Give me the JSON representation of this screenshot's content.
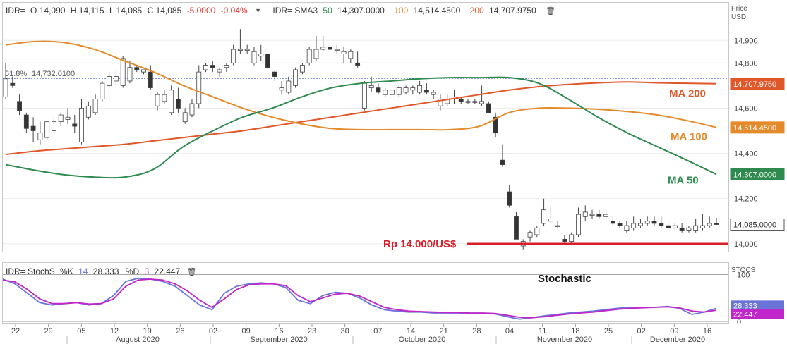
{
  "legend": {
    "symbol": "IDR=",
    "open_label": "O",
    "open": "14,090",
    "high_label": "H",
    "high": "14,115",
    "low_label": "L",
    "low": "14,085",
    "close_label": "C",
    "close": "14,085",
    "change": "-5.0000",
    "change_pct": "-0.04%",
    "sma_symbol": "IDR= SMA3",
    "sma50_period": "50",
    "sma50_value": "14,307.0000",
    "sma100_period": "100",
    "sma100_value": "14,514.4500",
    "sma200_period": "200",
    "sma200_value": "14,707.9750"
  },
  "stoch_legend": {
    "label": "IDR= StochS",
    "k_label": "%K",
    "k_period": "14",
    "k_value": "28.333",
    "d_label": "%D",
    "d_period": "3",
    "d_value": "22.447"
  },
  "axis": {
    "price_title": "Price",
    "price_unit": "USD",
    "price_ticks": [
      "14,000",
      "14,200",
      "14,400",
      "14,600",
      "14,800",
      "14,900"
    ],
    "price_tick_values": [
      14000,
      14200,
      14400,
      14600,
      14800,
      14900
    ],
    "stoch_title": "STOCS",
    "stoch_ticks": [
      "0",
      "100"
    ],
    "stoch_tick_values": [
      0,
      100
    ],
    "date_ticks": [
      "22",
      "29",
      "05",
      "12",
      "19",
      "26",
      "02",
      "09",
      "16",
      "23",
      "30",
      "07",
      "14",
      "21",
      "28",
      "04",
      "11",
      "18",
      "25",
      "02",
      "09",
      "16"
    ],
    "month_labels": [
      "August 2020",
      "September 2020",
      "October 2020",
      "November 2020",
      "December 2020"
    ]
  },
  "badges": {
    "ma200": {
      "text": "14,707.9750",
      "color": "#e0572a"
    },
    "ma100": {
      "text": "14,514.4500",
      "color": "#e38a2a"
    },
    "ma50": {
      "text": "14,307.0000",
      "color": "#2f8a4f"
    },
    "last": {
      "text": "14,085.0000",
      "color": "#ffffff"
    },
    "k": {
      "text": "28.333",
      "color": "#6a74d8"
    },
    "d": {
      "text": "22.447",
      "color": "#c026c9"
    }
  },
  "annotations": {
    "fib_label": "61.8%",
    "fib_value": "14,732.0100",
    "ma200_label": "MA 200",
    "ma100_label": "MA 100",
    "ma50_label": "MA 50",
    "support_label": "Rp 14.000/US$",
    "stoch_title": "Stochastic"
  },
  "chart_data": {
    "type": "candlestick",
    "ylim": [
      13965,
      14985
    ],
    "stoch_ylim": [
      -3,
      117
    ],
    "fib_level": 14732.01,
    "support_level": 14000,
    "colors": {
      "sma50": "#2f8a4f",
      "sma100": "#e38a2a",
      "sma200": "#e0572a",
      "support": "#d81e2a",
      "fib": "#3b4fb8",
      "stoch_k": "#6a74d8",
      "stoch_d": "#c026c9",
      "bull": "#ffffff",
      "bear": "#333333"
    },
    "candles": [
      {
        "o": 14650,
        "h": 14800,
        "l": 14640,
        "c": 14730
      },
      {
        "o": 14710,
        "h": 14740,
        "l": 14690,
        "c": 14700
      },
      {
        "o": 14630,
        "h": 14660,
        "l": 14570,
        "c": 14590
      },
      {
        "o": 14570,
        "h": 14580,
        "l": 14490,
        "c": 14510
      },
      {
        "o": 14520,
        "h": 14560,
        "l": 14450,
        "c": 14500
      },
      {
        "o": 14460,
        "h": 14540,
        "l": 14440,
        "c": 14490
      },
      {
        "o": 14470,
        "h": 14530,
        "l": 14460,
        "c": 14540
      },
      {
        "o": 14500,
        "h": 14560,
        "l": 14490,
        "c": 14540
      },
      {
        "o": 14540,
        "h": 14580,
        "l": 14520,
        "c": 14570
      },
      {
        "o": 14550,
        "h": 14600,
        "l": 14530,
        "c": 14560
      },
      {
        "o": 14530,
        "h": 14570,
        "l": 14490,
        "c": 14520
      },
      {
        "o": 14450,
        "h": 14640,
        "l": 14440,
        "c": 14600
      },
      {
        "o": 14560,
        "h": 14630,
        "l": 14550,
        "c": 14610
      },
      {
        "o": 14580,
        "h": 14660,
        "l": 14570,
        "c": 14640
      },
      {
        "o": 14640,
        "h": 14720,
        "l": 14630,
        "c": 14710
      },
      {
        "o": 14700,
        "h": 14760,
        "l": 14690,
        "c": 14740
      },
      {
        "o": 14720,
        "h": 14770,
        "l": 14700,
        "c": 14740
      },
      {
        "o": 14700,
        "h": 14830,
        "l": 14690,
        "c": 14820
      },
      {
        "o": 14720,
        "h": 14810,
        "l": 14710,
        "c": 14780
      },
      {
        "o": 14780,
        "h": 14790,
        "l": 14760,
        "c": 14770
      },
      {
        "o": 14760,
        "h": 14770,
        "l": 14750,
        "c": 14770
      },
      {
        "o": 14760,
        "h": 14790,
        "l": 14680,
        "c": 14690
      },
      {
        "o": 14610,
        "h": 14670,
        "l": 14590,
        "c": 14660
      },
      {
        "o": 14630,
        "h": 14680,
        "l": 14620,
        "c": 14660
      },
      {
        "o": 14580,
        "h": 14700,
        "l": 14570,
        "c": 14680
      },
      {
        "o": 14640,
        "h": 14690,
        "l": 14580,
        "c": 14600
      },
      {
        "o": 14540,
        "h": 14600,
        "l": 14530,
        "c": 14580
      },
      {
        "o": 14570,
        "h": 14640,
        "l": 14560,
        "c": 14620
      },
      {
        "o": 14620,
        "h": 14790,
        "l": 14600,
        "c": 14760
      },
      {
        "o": 14770,
        "h": 14800,
        "l": 14760,
        "c": 14790
      },
      {
        "o": 14790,
        "h": 14810,
        "l": 14760,
        "c": 14780
      },
      {
        "o": 14760,
        "h": 14780,
        "l": 14740,
        "c": 14770
      },
      {
        "o": 14780,
        "h": 14800,
        "l": 14760,
        "c": 14790
      },
      {
        "o": 14800,
        "h": 14880,
        "l": 14790,
        "c": 14860
      },
      {
        "o": 14860,
        "h": 14950,
        "l": 14840,
        "c": 14860
      },
      {
        "o": 14860,
        "h": 14880,
        "l": 14840,
        "c": 14860
      },
      {
        "o": 14800,
        "h": 14870,
        "l": 14790,
        "c": 14850
      },
      {
        "o": 14830,
        "h": 14880,
        "l": 14810,
        "c": 14840
      },
      {
        "o": 14840,
        "h": 14860,
        "l": 14760,
        "c": 14780
      },
      {
        "o": 14760,
        "h": 14770,
        "l": 14720,
        "c": 14740
      },
      {
        "o": 14680,
        "h": 14720,
        "l": 14660,
        "c": 14690
      },
      {
        "o": 14670,
        "h": 14740,
        "l": 14660,
        "c": 14720
      },
      {
        "o": 14700,
        "h": 14780,
        "l": 14690,
        "c": 14770
      },
      {
        "o": 14760,
        "h": 14800,
        "l": 14750,
        "c": 14790
      },
      {
        "o": 14800,
        "h": 14870,
        "l": 14790,
        "c": 14860
      },
      {
        "o": 14820,
        "h": 14920,
        "l": 14810,
        "c": 14860
      },
      {
        "o": 14860,
        "h": 14920,
        "l": 14850,
        "c": 14870
      },
      {
        "o": 14870,
        "h": 14920,
        "l": 14850,
        "c": 14860
      },
      {
        "o": 14860,
        "h": 14880,
        "l": 14840,
        "c": 14860
      },
      {
        "o": 14840,
        "h": 14870,
        "l": 14800,
        "c": 14850
      },
      {
        "o": 14820,
        "h": 14860,
        "l": 14800,
        "c": 14850
      },
      {
        "o": 14800,
        "h": 14850,
        "l": 14780,
        "c": 14790
      },
      {
        "o": 14600,
        "h": 14720,
        "l": 14590,
        "c": 14710
      },
      {
        "o": 14690,
        "h": 14740,
        "l": 14670,
        "c": 14700
      },
      {
        "o": 14690,
        "h": 14710,
        "l": 14660,
        "c": 14670
      },
      {
        "o": 14660,
        "h": 14690,
        "l": 14650,
        "c": 14680
      },
      {
        "o": 14660,
        "h": 14700,
        "l": 14650,
        "c": 14680
      },
      {
        "o": 14660,
        "h": 14700,
        "l": 14650,
        "c": 14690
      },
      {
        "o": 14670,
        "h": 14700,
        "l": 14660,
        "c": 14690
      },
      {
        "o": 14680,
        "h": 14700,
        "l": 14660,
        "c": 14690
      },
      {
        "o": 14670,
        "h": 14720,
        "l": 14660,
        "c": 14700
      },
      {
        "o": 14680,
        "h": 14710,
        "l": 14660,
        "c": 14670
      },
      {
        "o": 14660,
        "h": 14680,
        "l": 14640,
        "c": 14670
      },
      {
        "o": 14610,
        "h": 14660,
        "l": 14590,
        "c": 14640
      },
      {
        "o": 14620,
        "h": 14660,
        "l": 14610,
        "c": 14640
      },
      {
        "o": 14640,
        "h": 14680,
        "l": 14620,
        "c": 14650
      },
      {
        "o": 14640,
        "h": 14650,
        "l": 14620,
        "c": 14630
      },
      {
        "o": 14630,
        "h": 14640,
        "l": 14620,
        "c": 14630
      },
      {
        "o": 14630,
        "h": 14640,
        "l": 14620,
        "c": 14630
      },
      {
        "o": 14620,
        "h": 14700,
        "l": 14610,
        "c": 14630
      },
      {
        "o": 14620,
        "h": 14630,
        "l": 14580,
        "c": 14580
      },
      {
        "o": 14560,
        "h": 14580,
        "l": 14470,
        "c": 14490
      },
      {
        "o": 14370,
        "h": 14440,
        "l": 14340,
        "c": 14350
      },
      {
        "o": 14230,
        "h": 14260,
        "l": 14160,
        "c": 14170
      },
      {
        "o": 14120,
        "h": 14140,
        "l": 14020,
        "c": 14020
      },
      {
        "o": 13990,
        "h": 14020,
        "l": 13975,
        "c": 14010
      },
      {
        "o": 14030,
        "h": 14060,
        "l": 14010,
        "c": 14050
      },
      {
        "o": 14040,
        "h": 14080,
        "l": 14030,
        "c": 14070
      },
      {
        "o": 14090,
        "h": 14200,
        "l": 14080,
        "c": 14150
      },
      {
        "o": 14100,
        "h": 14170,
        "l": 14090,
        "c": 14110
      },
      {
        "o": 14080,
        "h": 14100,
        "l": 14070,
        "c": 14080
      },
      {
        "o": 14020,
        "h": 14040,
        "l": 14000,
        "c": 14010
      },
      {
        "o": 14010,
        "h": 14050,
        "l": 14000,
        "c": 14040
      },
      {
        "o": 14040,
        "h": 14160,
        "l": 14030,
        "c": 14130
      },
      {
        "o": 14120,
        "h": 14170,
        "l": 14100,
        "c": 14140
      },
      {
        "o": 14130,
        "h": 14150,
        "l": 14110,
        "c": 14130
      },
      {
        "o": 14130,
        "h": 14150,
        "l": 14110,
        "c": 14120
      },
      {
        "o": 14120,
        "h": 14150,
        "l": 14100,
        "c": 14130
      },
      {
        "o": 14100,
        "h": 14120,
        "l": 14080,
        "c": 14090
      },
      {
        "o": 14090,
        "h": 14100,
        "l": 14070,
        "c": 14080
      },
      {
        "o": 14060,
        "h": 14100,
        "l": 14050,
        "c": 14080
      },
      {
        "o": 14070,
        "h": 14120,
        "l": 14060,
        "c": 14090
      },
      {
        "o": 14080,
        "h": 14110,
        "l": 14070,
        "c": 14090
      },
      {
        "o": 14090,
        "h": 14120,
        "l": 14080,
        "c": 14100
      },
      {
        "o": 14100,
        "h": 14120,
        "l": 14080,
        "c": 14090
      },
      {
        "o": 14090,
        "h": 14120,
        "l": 14070,
        "c": 14080
      },
      {
        "o": 14080,
        "h": 14100,
        "l": 14060,
        "c": 14070
      },
      {
        "o": 14070,
        "h": 14090,
        "l": 14060,
        "c": 14080
      },
      {
        "o": 14070,
        "h": 14090,
        "l": 14050,
        "c": 14060
      },
      {
        "o": 14060,
        "h": 14080,
        "l": 14050,
        "c": 14070
      },
      {
        "o": 14060,
        "h": 14110,
        "l": 14050,
        "c": 14080
      },
      {
        "o": 14070,
        "h": 14130,
        "l": 14060,
        "c": 14080
      },
      {
        "o": 14080,
        "h": 14120,
        "l": 14070,
        "c": 14090
      },
      {
        "o": 14090,
        "h": 14115,
        "l": 14085,
        "c": 14085
      }
    ],
    "series": [
      {
        "name": "MA 200",
        "values": [
          14395,
          14410,
          14420,
          14430,
          14440,
          14455,
          14470,
          14485,
          14500,
          14520,
          14540,
          14560,
          14580,
          14600,
          14620,
          14640,
          14660,
          14680,
          14695,
          14705,
          14712,
          14716,
          14712,
          14710,
          14708
        ]
      },
      {
        "name": "MA 100",
        "values": [
          14880,
          14895,
          14890,
          14860,
          14810,
          14760,
          14700,
          14650,
          14600,
          14560,
          14530,
          14510,
          14505,
          14505,
          14505,
          14505,
          14520,
          14580,
          14600,
          14600,
          14595,
          14585,
          14570,
          14545,
          14515
        ]
      },
      {
        "name": "MA 50",
        "values": [
          14350,
          14325,
          14305,
          14295,
          14295,
          14330,
          14430,
          14500,
          14560,
          14600,
          14650,
          14690,
          14710,
          14720,
          14730,
          14735,
          14735,
          14735,
          14710,
          14640,
          14560,
          14490,
          14430,
          14370,
          14307
        ]
      }
    ],
    "stoch_series": [
      {
        "name": "%K",
        "values": [
          90,
          80,
          60,
          40,
          35,
          38,
          40,
          35,
          38,
          55,
          85,
          92,
          90,
          85,
          75,
          55,
          35,
          25,
          60,
          75,
          80,
          82,
          80,
          72,
          45,
          38,
          55,
          62,
          60,
          50,
          35,
          25,
          22,
          20,
          20,
          18,
          18,
          18,
          17,
          17,
          16,
          10,
          5,
          8,
          12,
          15,
          18,
          20,
          22,
          25,
          28,
          30,
          30,
          30,
          32,
          28,
          15,
          20,
          28
        ]
      },
      {
        "name": "%D",
        "values": [
          88,
          84,
          68,
          48,
          38,
          38,
          40,
          37,
          38,
          48,
          75,
          88,
          90,
          88,
          80,
          65,
          45,
          30,
          48,
          68,
          78,
          80,
          80,
          76,
          55,
          42,
          50,
          58,
          60,
          54,
          42,
          30,
          25,
          22,
          21,
          20,
          19,
          19,
          18,
          18,
          17,
          13,
          9,
          8,
          10,
          13,
          16,
          18,
          20,
          23,
          26,
          28,
          29,
          30,
          31,
          29,
          22,
          20,
          24
        ]
      }
    ]
  }
}
